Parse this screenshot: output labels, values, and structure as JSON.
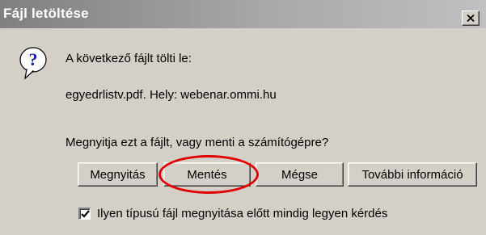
{
  "window": {
    "title": "Fájl letöltése",
    "close_label": "×"
  },
  "icons": {
    "question": "question-icon",
    "close": "close-icon",
    "check": "checkmark-icon"
  },
  "content": {
    "line1": "A következő fájlt tölti le:",
    "line2": "egyedrlistv.pdf. Hely: webenar.ommi.hu",
    "prompt": "Megnyitja ezt a fájlt, vagy menti a számítógépre?"
  },
  "buttons": {
    "open": "Megnyitás",
    "save": "Mentés",
    "cancel": "Mégse",
    "more_info": "További információ"
  },
  "checkbox": {
    "checked": true,
    "label": "Ilyen típusú fájl megnyitása előtt mindig legyen kérdés"
  },
  "colors": {
    "dialog_bg": "#d4d0c8",
    "titlebar_start": "#808080",
    "titlebar_end": "#c0c0c0",
    "highlight": "#e00000"
  }
}
